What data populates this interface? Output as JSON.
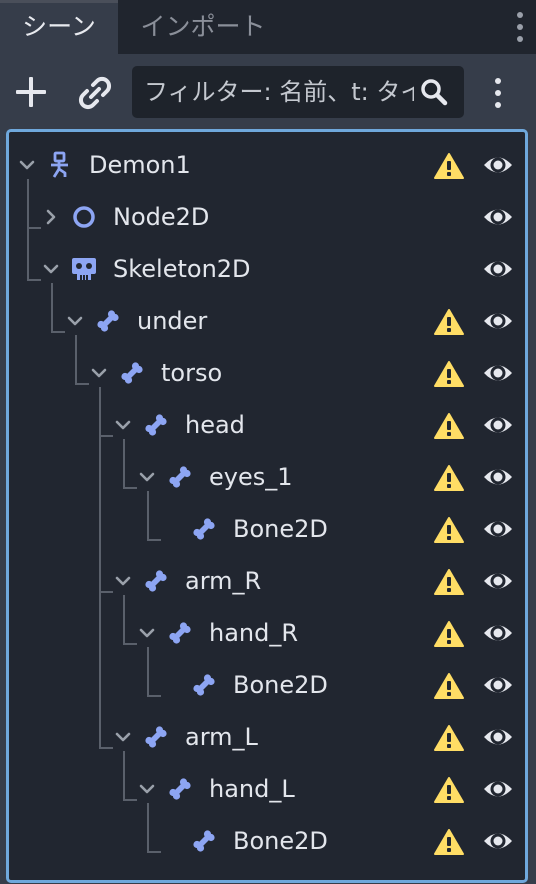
{
  "tabs": [
    {
      "label": "シーン",
      "active": true
    },
    {
      "label": "インポート",
      "active": false
    }
  ],
  "toolbar": {
    "add_icon": "plus-icon",
    "link_icon": "link-icon",
    "filter_placeholder": "フィルター: 名前、t: タイプ",
    "search_icon": "search-icon",
    "more_icon": "kebab-menu-icon"
  },
  "colors": {
    "panel_bg": "#363d4a",
    "tree_bg": "#212630",
    "tree_border": "#6fa8dc",
    "bone_icon": "#8da5f3",
    "warning": "#ffdd65",
    "eye": "#e6e8ee"
  },
  "tree": [
    {
      "name": "Demon1",
      "type": "Node2D-root",
      "icon": "character-body-icon",
      "depth": 0,
      "expanded": true,
      "warning": true,
      "visible": true
    },
    {
      "name": "Node2D",
      "type": "Node2D",
      "icon": "node2d-icon",
      "depth": 1,
      "expanded": false,
      "warning": false,
      "visible": true
    },
    {
      "name": "Skeleton2D",
      "type": "Skeleton2D",
      "icon": "skeleton-icon",
      "depth": 1,
      "expanded": true,
      "warning": false,
      "visible": true
    },
    {
      "name": "under",
      "type": "Bone2D",
      "icon": "bone-icon",
      "depth": 2,
      "expanded": true,
      "warning": true,
      "visible": true
    },
    {
      "name": "torso",
      "type": "Bone2D",
      "icon": "bone-icon",
      "depth": 3,
      "expanded": true,
      "warning": true,
      "visible": true
    },
    {
      "name": "head",
      "type": "Bone2D",
      "icon": "bone-icon",
      "depth": 4,
      "expanded": true,
      "warning": true,
      "visible": true
    },
    {
      "name": "eyes_1",
      "type": "Bone2D",
      "icon": "bone-icon",
      "depth": 5,
      "expanded": true,
      "warning": true,
      "visible": true
    },
    {
      "name": "Bone2D",
      "type": "Bone2D",
      "icon": "bone-icon",
      "depth": 6,
      "expanded": null,
      "warning": true,
      "visible": true
    },
    {
      "name": "arm_R",
      "type": "Bone2D",
      "icon": "bone-icon",
      "depth": 4,
      "expanded": true,
      "warning": true,
      "visible": true
    },
    {
      "name": "hand_R",
      "type": "Bone2D",
      "icon": "bone-icon",
      "depth": 5,
      "expanded": true,
      "warning": true,
      "visible": true
    },
    {
      "name": "Bone2D",
      "type": "Bone2D",
      "icon": "bone-icon",
      "depth": 6,
      "expanded": null,
      "warning": true,
      "visible": true
    },
    {
      "name": "arm_L",
      "type": "Bone2D",
      "icon": "bone-icon",
      "depth": 4,
      "expanded": true,
      "warning": true,
      "visible": true
    },
    {
      "name": "hand_L",
      "type": "Bone2D",
      "icon": "bone-icon",
      "depth": 5,
      "expanded": true,
      "warning": true,
      "visible": true
    },
    {
      "name": "Bone2D",
      "type": "Bone2D",
      "icon": "bone-icon",
      "depth": 6,
      "expanded": null,
      "warning": true,
      "visible": true
    }
  ]
}
